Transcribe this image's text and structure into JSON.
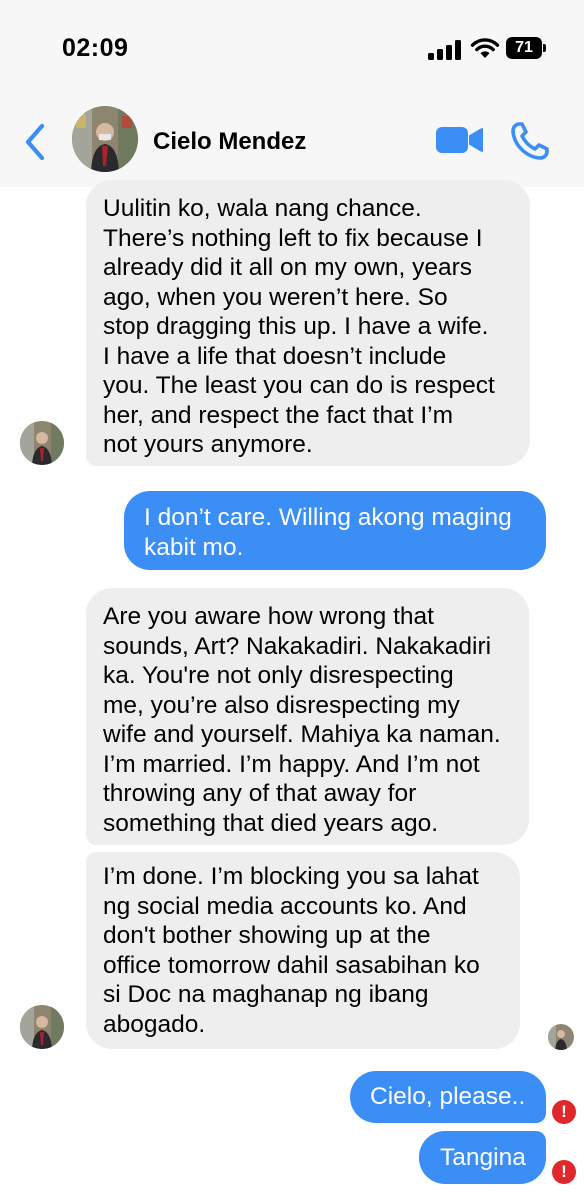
{
  "status_bar": {
    "time": "02:09",
    "battery": "71"
  },
  "header": {
    "contact_name": "Cielo Mendez",
    "icons": [
      "back-chevron-icon",
      "contact-avatar",
      "video-camera-icon",
      "phone-icon"
    ],
    "accent_color": "#3a8ef6"
  },
  "messages": [
    {
      "from": "contact",
      "text": "Uulitin ko, wala nang chance.\nThere’s nothing left to fix because I\nalready did it all on my own, years\nago, when you weren’t here. So\nstop dragging this up. I have a wife.\nI have a life that doesn’t include\nyou. The least you can do is respect\nher, and respect the fact that I’m\nnot yours anymore."
    },
    {
      "from": "me",
      "text": "I don’t care. Willing akong maging\nkabit mo."
    },
    {
      "from": "contact",
      "text": "Are you aware how wrong that\nsounds, Art? Nakakadiri. Nakakadiri\nka. You're not only disrespecting\nme, you’re also disrespecting my\nwife and yourself. Mahiya ka naman.\nI’m married. I’m happy. And I’m not\nthrowing any of that away for\nsomething that died years ago."
    },
    {
      "from": "contact",
      "text": "I’m done. I’m blocking you sa lahat\nng social media accounts ko. And\ndon't bother showing up at the\noffice tomorrow dahil sasabihan ko\nsi Doc na maghanap ng ibang\nabogado."
    },
    {
      "from": "me",
      "text": "Cielo, please..",
      "status": "!"
    },
    {
      "from": "me",
      "text": "Tangina",
      "status": "!"
    }
  ],
  "colors": {
    "sent_bubble": "#3a8ef6",
    "received_bubble": "#eeeeef",
    "error_badge": "#e0272b"
  }
}
